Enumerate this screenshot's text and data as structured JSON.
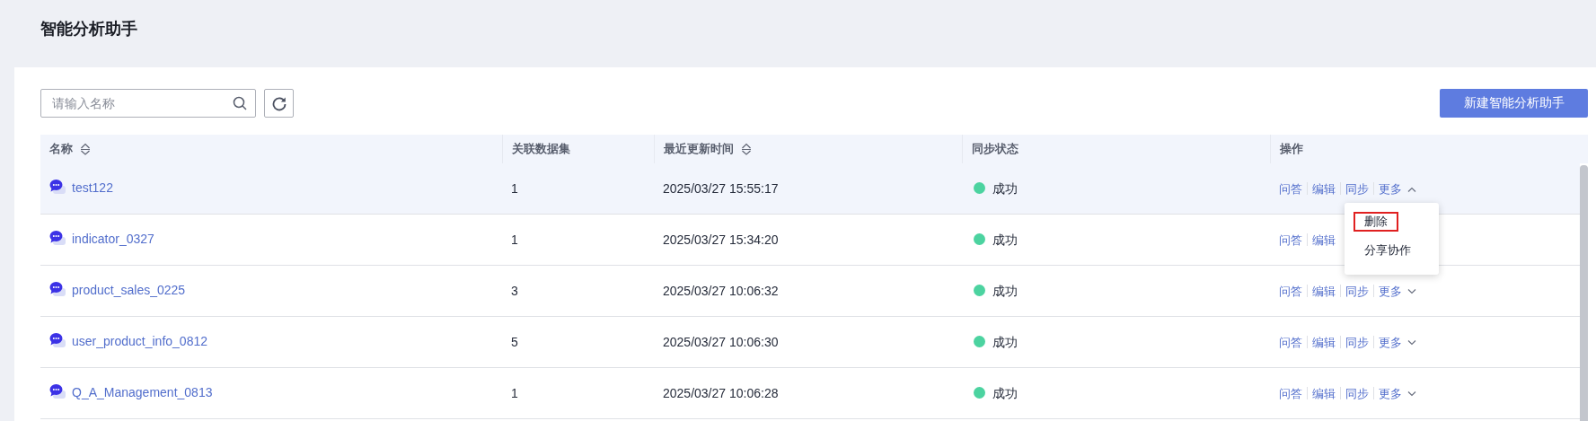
{
  "page_title": "智能分析助手",
  "search": {
    "placeholder": "请输入名称"
  },
  "new_button": "新建智能分析助手",
  "table": {
    "columns": [
      {
        "label": "名称",
        "sortable": true
      },
      {
        "label": "关联数据集",
        "sortable": false
      },
      {
        "label": "最近更新时间",
        "sortable": true
      },
      {
        "label": "同步状态",
        "sortable": false
      },
      {
        "label": "操作",
        "sortable": false
      }
    ],
    "rows": [
      {
        "name": "test122",
        "datasets": "1",
        "updated": "2025/03/27 15:55:17",
        "status": {
          "label": "成功",
          "color": "#4cd3a0"
        },
        "hovered": true,
        "actions": [
          "问答",
          "编辑",
          "同步"
        ],
        "more": {
          "label": "更多",
          "expanded": true,
          "menu": [
            {
              "label": "删除",
              "highlighted": true
            },
            {
              "label": "分享协作",
              "highlighted": false
            }
          ]
        }
      },
      {
        "name": "indicator_0327",
        "datasets": "1",
        "updated": "2025/03/27 15:34:20",
        "status": {
          "label": "成功",
          "color": "#4cd3a0"
        },
        "hovered": false,
        "actions": [
          "问答",
          "编辑"
        ]
      },
      {
        "name": "product_sales_0225",
        "datasets": "3",
        "updated": "2025/03/27 10:06:32",
        "status": {
          "label": "成功",
          "color": "#4cd3a0"
        },
        "hovered": false,
        "actions": [
          "问答",
          "编辑",
          "同步"
        ],
        "more": {
          "label": "更多",
          "expanded": false
        }
      },
      {
        "name": "user_product_info_0812",
        "datasets": "5",
        "updated": "2025/03/27 10:06:30",
        "status": {
          "label": "成功",
          "color": "#4cd3a0"
        },
        "hovered": false,
        "actions": [
          "问答",
          "编辑",
          "同步"
        ],
        "more": {
          "label": "更多",
          "expanded": false
        }
      },
      {
        "name": "Q_A_Management_0813",
        "datasets": "1",
        "updated": "2025/03/27 10:06:28",
        "status": {
          "label": "成功",
          "color": "#4cd3a0"
        },
        "hovered": false,
        "actions": [
          "问答",
          "编辑",
          "同步"
        ],
        "more": {
          "label": "更多",
          "expanded": false
        }
      }
    ]
  }
}
